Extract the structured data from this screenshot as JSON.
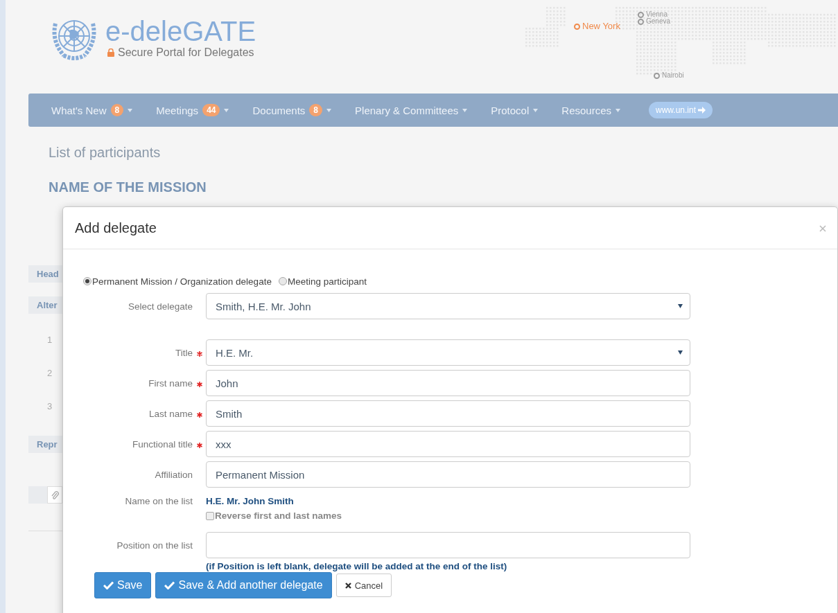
{
  "header": {
    "logo_title": "e-deleGATE",
    "logo_subtitle": "Secure Portal for Delegates",
    "map_cities": [
      {
        "name": "New York",
        "color": "#f08a4b"
      },
      {
        "name": "Vienna",
        "color": "#9a9a9a"
      },
      {
        "name": "Geneva",
        "color": "#9a9a9a"
      },
      {
        "name": "Nairobi",
        "color": "#9a9a9a"
      }
    ]
  },
  "nav": {
    "items": [
      {
        "label": "What's New",
        "badge": "8"
      },
      {
        "label": "Meetings",
        "badge": "44"
      },
      {
        "label": "Documents",
        "badge": "8"
      },
      {
        "label": "Plenary & Committees"
      },
      {
        "label": "Protocol"
      },
      {
        "label": "Resources"
      }
    ],
    "link": "www.un.int"
  },
  "page": {
    "title": "List of participants",
    "mission_name": "NAME OF THE MISSION",
    "section_labels": [
      "Head",
      "Alter"
    ],
    "row_numbers": [
      "1",
      "2",
      "3"
    ],
    "lower_section_label": "Repr"
  },
  "modal": {
    "title": "Add delegate",
    "radios": [
      {
        "label": "Permanent Mission / Organization delegate",
        "selected": true
      },
      {
        "label": "Meeting participant",
        "selected": false
      }
    ],
    "fields": [
      {
        "label": "Select delegate",
        "kind": "select",
        "required": false,
        "value": "Smith, H.E. Mr. John"
      },
      {
        "label": "Title",
        "kind": "select",
        "required": true,
        "value": "H.E. Mr."
      },
      {
        "label": "First name",
        "kind": "text",
        "required": true,
        "value": "John"
      },
      {
        "label": "Last name",
        "kind": "text",
        "required": true,
        "value": "Smith"
      },
      {
        "label": "Functional title",
        "kind": "text",
        "required": true,
        "value": "xxx"
      },
      {
        "label": "Affiliation",
        "kind": "text",
        "required": false,
        "value": "Permanent Mission"
      }
    ],
    "name_on_list": {
      "label": "Name on the list",
      "value": "H.E. Mr. John Smith"
    },
    "reverse_checkbox": {
      "label": "Reverse first and last names",
      "checked": false
    },
    "position_field": {
      "label": "Position on the list"
    },
    "position_hint": "(if Position is left blank, delegate will be added at the end of the list)",
    "buttons": [
      {
        "label": "Save",
        "kind": "primary"
      },
      {
        "label": "Save & Add another delegate",
        "kind": "primary"
      },
      {
        "label": "Cancel",
        "kind": "default"
      }
    ]
  }
}
